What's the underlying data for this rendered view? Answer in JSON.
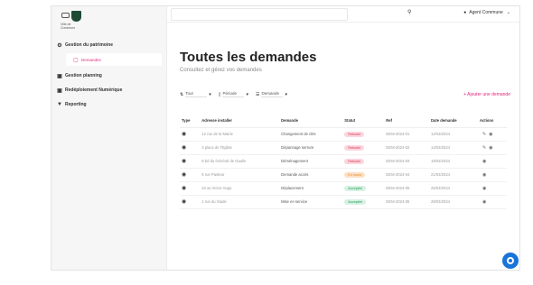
{
  "colors": {
    "accent": "#e0287c",
    "brand": "#1f4a34",
    "chat": "#1a73d9"
  },
  "logo": {
    "text": "Ville de Commune"
  },
  "sidebar": {
    "items": [
      {
        "label": "Gestion du patrimoine",
        "icon": "gear-icon"
      },
      {
        "label": "Demandes",
        "icon": "calendar-icon",
        "active": true
      },
      {
        "label": "Gestion planning",
        "icon": "calendar-icon"
      },
      {
        "label": "Redéploiement Numérique",
        "icon": "calendar-icon"
      },
      {
        "label": "Reporting",
        "icon": "chart-icon"
      }
    ]
  },
  "topbar": {
    "search_placeholder": "",
    "user": "Agent Commune"
  },
  "main": {
    "title": "Toutes les demandes",
    "subtitle": "Consultez et gérez vos demandes",
    "filters": [
      {
        "label": "Tout",
        "icon": "sort-icon"
      },
      {
        "label": "Période",
        "icon": "calendar-icon"
      },
      {
        "label": "Demande",
        "icon": "list-icon"
      }
    ],
    "add_label": "+ Ajouter une demande"
  },
  "table": {
    "headers": [
      "Type",
      "Adresse installer",
      "Demande",
      "Statut",
      "Ref",
      "Date demande",
      "Actions"
    ],
    "rows": [
      {
        "type": "◉",
        "address": "12 rue de la Mairie",
        "demande": "Changement de clés",
        "status": "Refusée",
        "status_color": "red",
        "ref": "DEM-2024-01",
        "date": "12/03/2024",
        "actions": [
          "edit-icon",
          "eye-icon"
        ]
      },
      {
        "type": "◉",
        "address": "3 place de l'Eglise",
        "demande": "Dépannage serrure",
        "status": "Refusée",
        "status_color": "red",
        "ref": "DEM-2024-02",
        "date": "14/03/2024",
        "actions": [
          "edit-icon",
          "eye-icon"
        ]
      },
      {
        "type": "◉",
        "address": "8 bd du Général de Gaulle",
        "demande": "Déménagement",
        "status": "Refusée",
        "status_color": "red",
        "ref": "DEM-2024-03",
        "date": "18/03/2024",
        "actions": [
          "eye-icon"
        ]
      },
      {
        "type": "◉",
        "address": "5 rue Pasteur",
        "demande": "Demande accès",
        "status": "En cours",
        "status_color": "orange",
        "ref": "DEM-2024-04",
        "date": "21/03/2024",
        "actions": [
          "eye-icon"
        ]
      },
      {
        "type": "◉",
        "address": "22 av Victor Hugo",
        "demande": "Déplacement",
        "status": "Acceptée",
        "status_color": "green",
        "ref": "DEM-2024-05",
        "date": "25/03/2024",
        "actions": [
          "eye-icon"
        ]
      },
      {
        "type": "◉",
        "address": "1 rue du Stade",
        "demande": "Mise en service",
        "status": "Acceptée",
        "status_color": "green",
        "ref": "DEM-2024-06",
        "date": "28/03/2024",
        "actions": [
          "eye-icon"
        ]
      }
    ]
  }
}
